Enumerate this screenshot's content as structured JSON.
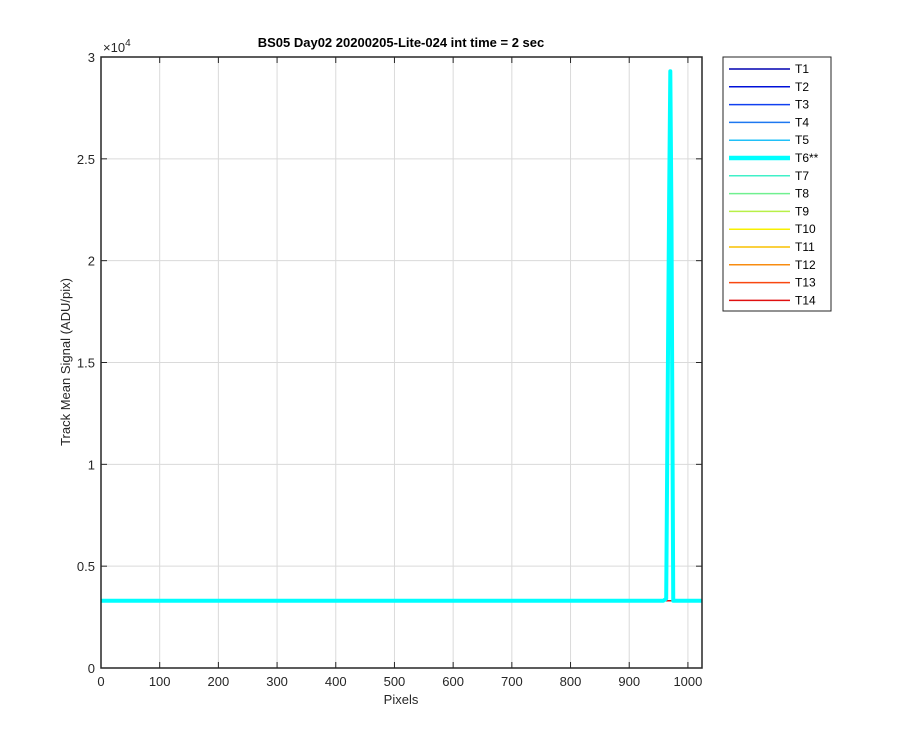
{
  "chart_data": {
    "type": "line",
    "title": "BS05 Day02 20200205-Lite-024 int time = 2 sec",
    "xlabel": "Pixels",
    "ylabel": "Track Mean Signal (ADU/pix)",
    "xlim": [
      0,
      1024
    ],
    "ylim": [
      0,
      30000
    ],
    "y_exponent_label": "×10",
    "y_exponent_power": "4",
    "x_ticks": [
      0,
      100,
      200,
      300,
      400,
      500,
      600,
      700,
      800,
      900,
      1000
    ],
    "x_tick_labels": [
      "0",
      "100",
      "200",
      "300",
      "400",
      "500",
      "600",
      "700",
      "800",
      "900",
      "1000"
    ],
    "y_ticks": [
      0,
      5000,
      10000,
      15000,
      20000,
      25000,
      30000
    ],
    "y_tick_labels": [
      "0",
      "0.5",
      "1",
      "1.5",
      "2",
      "2.5",
      "3"
    ],
    "grid": true,
    "legend_placement": "outside-right",
    "series": [
      {
        "name": "T1",
        "color": "#0000b0",
        "highlight": false,
        "x": [
          0,
          1024
        ],
        "y": [
          3300,
          3300
        ]
      },
      {
        "name": "T2",
        "color": "#0010d8",
        "highlight": false,
        "x": [
          0,
          1024
        ],
        "y": [
          3300,
          3300
        ]
      },
      {
        "name": "T3",
        "color": "#1040f0",
        "highlight": false,
        "x": [
          0,
          1024
        ],
        "y": [
          3300,
          3300
        ]
      },
      {
        "name": "T4",
        "color": "#1e78f0",
        "highlight": false,
        "x": [
          0,
          1024
        ],
        "y": [
          3300,
          3300
        ]
      },
      {
        "name": "T5",
        "color": "#20c0f8",
        "highlight": false,
        "x": [
          0,
          1024
        ],
        "y": [
          3300,
          3300
        ]
      },
      {
        "name": "T6**",
        "color": "#00ffff",
        "highlight": true,
        "x": [
          0,
          958,
          963,
          968,
          970,
          972,
          975,
          1024
        ],
        "y": [
          3300,
          3300,
          3400,
          23000,
          29300,
          22000,
          3300,
          3300
        ]
      },
      {
        "name": "T7",
        "color": "#40f0c8",
        "highlight": false,
        "x": [
          0,
          1024
        ],
        "y": [
          3300,
          3300
        ]
      },
      {
        "name": "T8",
        "color": "#70f090",
        "highlight": false,
        "x": [
          0,
          1024
        ],
        "y": [
          3300,
          3300
        ]
      },
      {
        "name": "T9",
        "color": "#b8f048",
        "highlight": false,
        "x": [
          0,
          1024
        ],
        "y": [
          3300,
          3300
        ]
      },
      {
        "name": "T10",
        "color": "#f8f000",
        "highlight": false,
        "x": [
          0,
          1024
        ],
        "y": [
          3300,
          3300
        ]
      },
      {
        "name": "T11",
        "color": "#f8c000",
        "highlight": false,
        "x": [
          0,
          1024
        ],
        "y": [
          3300,
          3300
        ]
      },
      {
        "name": "T12",
        "color": "#f88c10",
        "highlight": false,
        "x": [
          0,
          1024
        ],
        "y": [
          3300,
          3300
        ]
      },
      {
        "name": "T13",
        "color": "#f84810",
        "highlight": false,
        "x": [
          0,
          1024
        ],
        "y": [
          3300,
          3300
        ]
      },
      {
        "name": "T14",
        "color": "#e01010",
        "highlight": false,
        "x": [
          0,
          1024
        ],
        "y": [
          3300,
          3300
        ]
      }
    ]
  }
}
